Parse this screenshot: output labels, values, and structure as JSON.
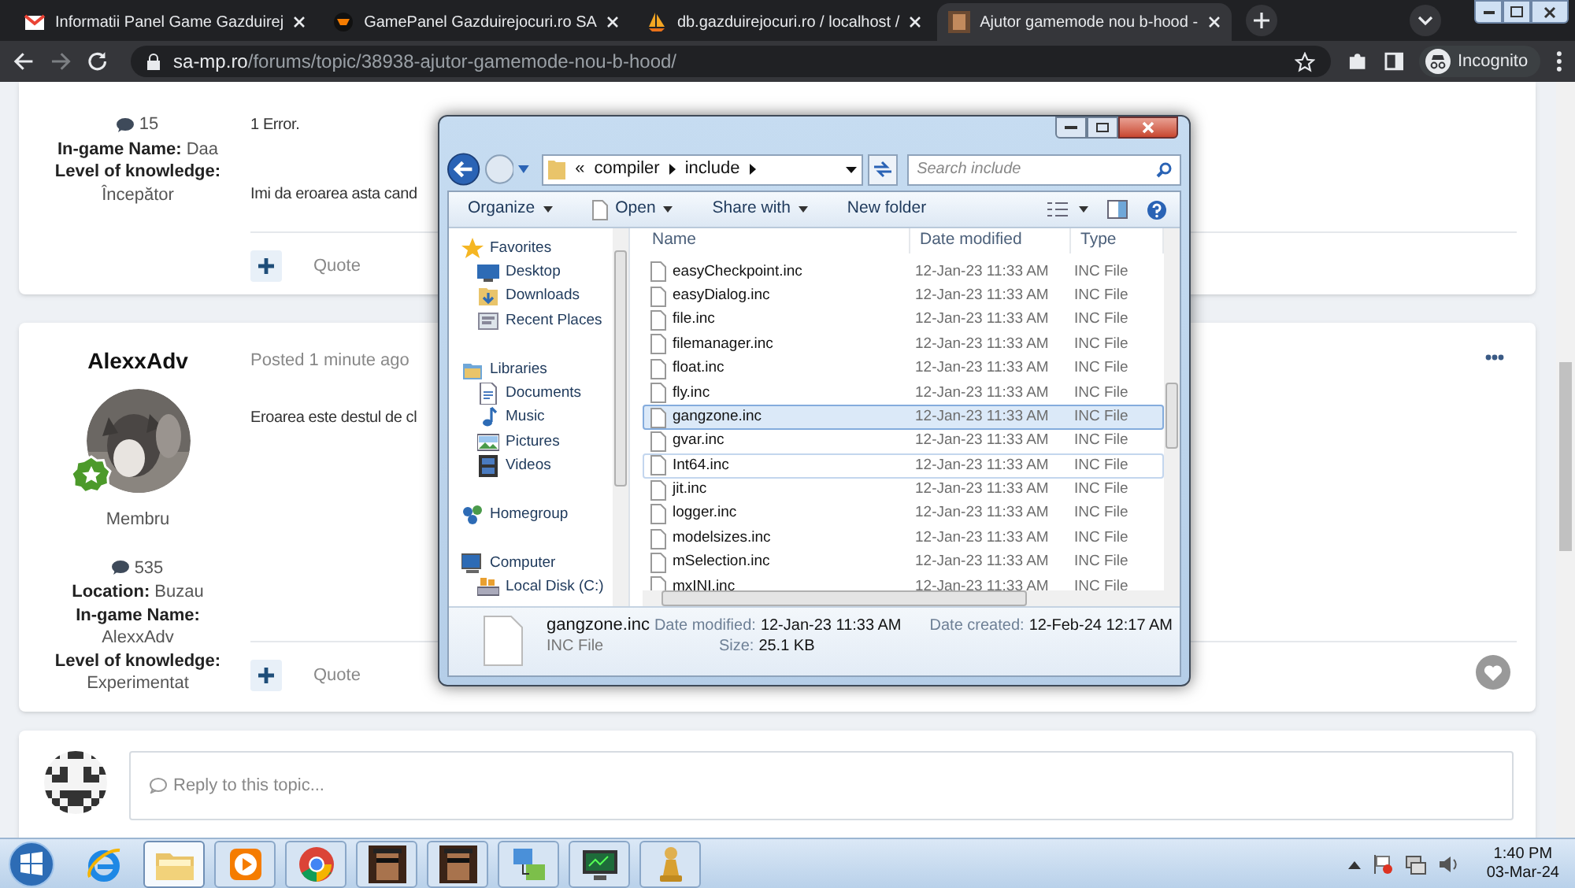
{
  "browser": {
    "tabs": [
      {
        "title": "Informatii Panel Game Gazduirej",
        "selected": false
      },
      {
        "title": "GamePanel Gazduirejocuri.ro SA",
        "selected": false
      },
      {
        "title": "db.gazduirejocuri.ro / localhost /",
        "selected": false
      },
      {
        "title": "Ajutor gamemode nou b-hood -",
        "selected": true
      }
    ],
    "url_host": "sa-mp.ro",
    "url_path": "/forums/topic/38938-ajutor-gamemode-nou-b-hood/",
    "profile": "Incognito"
  },
  "post_1": {
    "post_count": "15",
    "fields": [
      {
        "label": "In-game Name:",
        "value": "Daa",
        "inline": true
      },
      {
        "label": "Level of knowledge:",
        "value": "Începător",
        "inline": false
      }
    ],
    "body": [
      "1 Error.",
      "Imi da eroarea asta cand"
    ],
    "action": "Quote"
  },
  "post_2": {
    "author": "AlexxAdv",
    "rank": "Membru",
    "post_count": "535",
    "fields": [
      {
        "label": "Location:",
        "value": "Buzau",
        "inline": true
      },
      {
        "label": "In-game Name:",
        "value": "AlexxAdv",
        "inline": false
      },
      {
        "label": "Level of knowledge:",
        "value": "Experimentat",
        "inline": false
      }
    ],
    "posted": "Posted 1 minute ago",
    "body": [
      "Eroarea este destul de cl"
    ],
    "action": "Quote"
  },
  "reply": {
    "placeholder": "Reply to this topic..."
  },
  "explorer": {
    "path_prefix": "«",
    "path": [
      "compiler",
      "include"
    ],
    "search_placeholder": "Search include",
    "toolbar": [
      {
        "label": "Organize",
        "menu": true
      },
      {
        "label": "Open",
        "menu": true
      },
      {
        "label": "Share with",
        "menu": true
      },
      {
        "label": "New folder",
        "menu": false
      }
    ],
    "columns": [
      "Name",
      "Date modified",
      "Type"
    ],
    "nav": [
      {
        "label": "Favorites",
        "children": [
          {
            "label": "Desktop"
          },
          {
            "label": "Downloads"
          },
          {
            "label": "Recent Places"
          }
        ]
      },
      {
        "label": "Libraries",
        "children": [
          {
            "label": "Documents"
          },
          {
            "label": "Music"
          },
          {
            "label": "Pictures"
          },
          {
            "label": "Videos"
          }
        ]
      },
      {
        "label": "Homegroup"
      },
      {
        "label": "Computer",
        "children": [
          {
            "label": "Local Disk (C:)"
          }
        ]
      }
    ],
    "files": [
      {
        "name": "easyCheckpoint.inc",
        "date": "12-Jan-23 11:33 AM",
        "type": "INC File",
        "selected": false,
        "hovered": false
      },
      {
        "name": "easyDialog.inc",
        "date": "12-Jan-23 11:33 AM",
        "type": "INC File",
        "selected": false,
        "hovered": false
      },
      {
        "name": "file.inc",
        "date": "12-Jan-23 11:33 AM",
        "type": "INC File",
        "selected": false,
        "hovered": false
      },
      {
        "name": "filemanager.inc",
        "date": "12-Jan-23 11:33 AM",
        "type": "INC File",
        "selected": false,
        "hovered": false
      },
      {
        "name": "float.inc",
        "date": "12-Jan-23 11:33 AM",
        "type": "INC File",
        "selected": false,
        "hovered": false
      },
      {
        "name": "fly.inc",
        "date": "12-Jan-23 11:33 AM",
        "type": "INC File",
        "selected": false,
        "hovered": false
      },
      {
        "name": "gangzone.inc",
        "date": "12-Jan-23 11:33 AM",
        "type": "INC File",
        "selected": true,
        "hovered": false
      },
      {
        "name": "gvar.inc",
        "date": "12-Jan-23 11:33 AM",
        "type": "INC File",
        "selected": false,
        "hovered": false
      },
      {
        "name": "Int64.inc",
        "date": "12-Jan-23 11:33 AM",
        "type": "INC File",
        "selected": false,
        "hovered": true
      },
      {
        "name": "jit.inc",
        "date": "12-Jan-23 11:33 AM",
        "type": "INC File",
        "selected": false,
        "hovered": false
      },
      {
        "name": "logger.inc",
        "date": "12-Jan-23 11:33 AM",
        "type": "INC File",
        "selected": false,
        "hovered": false
      },
      {
        "name": "modelsizes.inc",
        "date": "12-Jan-23 11:33 AM",
        "type": "INC File",
        "selected": false,
        "hovered": false
      },
      {
        "name": "mSelection.inc",
        "date": "12-Jan-23 11:33 AM",
        "type": "INC File",
        "selected": false,
        "hovered": false
      },
      {
        "name": "mxINI.inc",
        "date": "12-Jan-23 11:33 AM",
        "type": "INC File",
        "selected": false,
        "hovered": false
      }
    ],
    "details": {
      "name": "gangzone.inc",
      "type": "INC File",
      "fields": [
        {
          "label": "Date modified:",
          "value": "12-Jan-23 11:33 AM"
        },
        {
          "label": "Date created:",
          "value": "12-Feb-24 12:17 AM"
        },
        {
          "label": "Size:",
          "value": "25.1 KB"
        }
      ]
    }
  },
  "taskbar": {
    "apps": [
      {
        "active": false
      },
      {
        "active": true
      },
      {
        "active": false
      },
      {
        "active": false
      },
      {
        "active": false
      },
      {
        "active": false
      },
      {
        "active": false
      },
      {
        "active": false
      },
      {
        "active": false
      }
    ],
    "time": "1:40 PM",
    "date": "03-Mar-24"
  }
}
